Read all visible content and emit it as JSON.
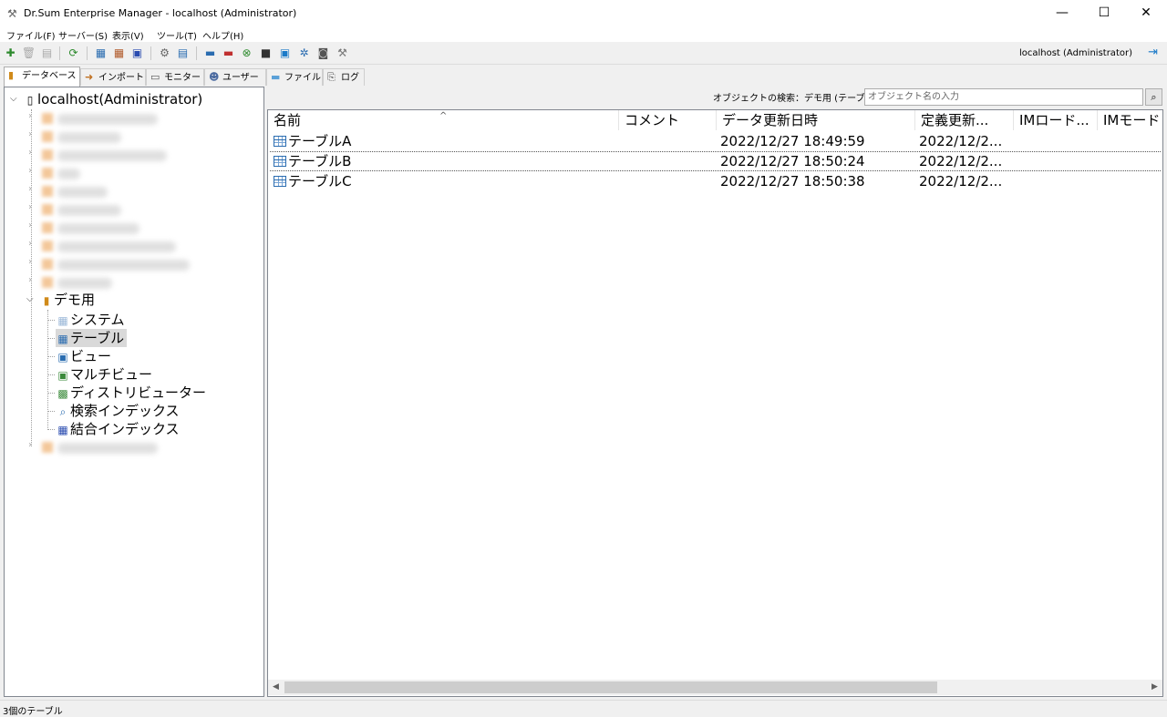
{
  "window": {
    "title": "Dr.Sum Enterprise Manager - localhost (Administrator)",
    "app_icon": "tools-icon",
    "controls": {
      "minimize": "—",
      "maximize": "☐",
      "close": "✕"
    }
  },
  "menu": [
    "ファイル(F)",
    "サーバー(S)",
    "表示(V)",
    "ツール(T)",
    "ヘルプ(H)"
  ],
  "toolbar": {
    "connection_label": "localhost (Administrator)"
  },
  "tabs": [
    {
      "label": "データベース",
      "icon": "database-icon",
      "active": true
    },
    {
      "label": "インポート",
      "icon": "import-icon",
      "active": false
    },
    {
      "label": "モニター",
      "icon": "monitor-icon",
      "active": false
    },
    {
      "label": "ユーザー",
      "icon": "users-icon",
      "active": false
    },
    {
      "label": "ファイル",
      "icon": "folder-icon",
      "active": false
    },
    {
      "label": "ログ",
      "icon": "log-icon",
      "active": false
    }
  ],
  "tree": {
    "root": "localhost(Administrator)",
    "database": "デモ用",
    "children": [
      "システム",
      "テーブル",
      "ビュー",
      "マルチビュー",
      "ディストリビューター",
      "検索インデックス",
      "結合インデックス"
    ],
    "selected": "テーブル"
  },
  "search": {
    "label": "オブジェクトの検索：デモ用 (テーブル)",
    "placeholder": "オブジェクト名の入力"
  },
  "list": {
    "columns": [
      "名前",
      "コメント",
      "データ更新日時",
      "定義更新...",
      "IMロード...",
      "IMモード"
    ],
    "rows": [
      {
        "name": "テーブルA",
        "comment": "",
        "data_updated": "2022/12/27 18:49:59",
        "def_updated": "2022/12/2..."
      },
      {
        "name": "テーブルB",
        "comment": "",
        "data_updated": "2022/12/27 18:50:24",
        "def_updated": "2022/12/2..."
      },
      {
        "name": "テーブルC",
        "comment": "",
        "data_updated": "2022/12/27 18:50:38",
        "def_updated": "2022/12/2..."
      }
    ]
  },
  "status": "3個のテーブル"
}
